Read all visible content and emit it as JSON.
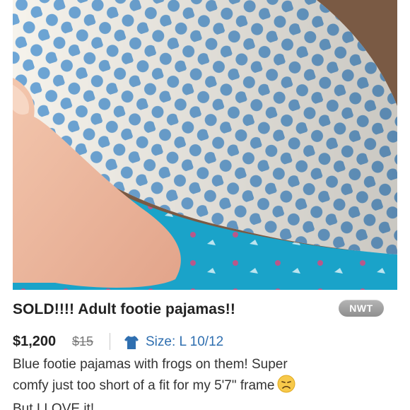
{
  "listing": {
    "photo_alt": "",
    "title": "SOLD!!!! Adult footie pajamas!!",
    "condition_badge": "NWT",
    "price": "$1,200",
    "original_price": "$15",
    "size_label": "Size: L 10/12",
    "description_line1": "Blue footie pajamas with frogs on them! Super",
    "description_line2": "comfy just too short of a fit for my 5'7\" frame",
    "description_line3": "But I LOVE it!",
    "emoji_icon": "disappointed-face-icon",
    "size_icon": "shirt-icon"
  },
  "colors": {
    "title": "#222222",
    "size_link": "#2f6fb0",
    "badge": "#9e9e9e",
    "polka_dot": "#6ea6d6",
    "fleece": "#1aa3c9"
  }
}
